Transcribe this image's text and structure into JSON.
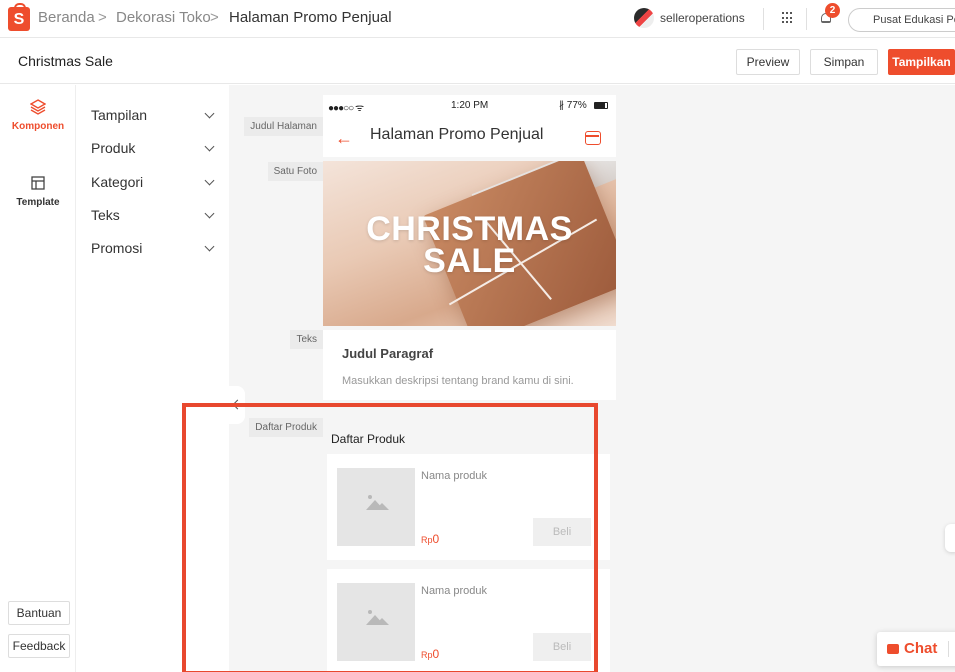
{
  "header": {
    "logo_letter": "S",
    "breadcrumbs": [
      "Beranda",
      "Dekorasi Toko",
      "Halaman Promo Penjual"
    ],
    "separator": ">",
    "username": "selleroperations",
    "notification_count": "2",
    "edu_button": "Pusat Edukasi Penjual"
  },
  "subheader": {
    "title": "Christmas Sale",
    "preview": "Preview",
    "save": "Simpan",
    "publish": "Tampilkan"
  },
  "rail": {
    "items": [
      {
        "label": "Komponen",
        "icon": "layers-icon",
        "active": true
      },
      {
        "label": "Template",
        "icon": "template-icon",
        "active": false
      }
    ],
    "help": "Bantuan",
    "feedback": "Feedback"
  },
  "components": [
    "Tampilan",
    "Produk",
    "Kategori",
    "Teks",
    "Promosi"
  ],
  "section_labels": [
    "Judul Halaman",
    "Satu Foto",
    "Teks",
    "Daftar Produk"
  ],
  "phone": {
    "status_left": "●●●○○ ᯤ",
    "time": "1:20 PM",
    "battery": "∦ 77%",
    "title": "Halaman Promo Penjual",
    "banner_line1": "CHRISTMAS",
    "banner_line2": "SALE",
    "para_title": "Judul Paragraf",
    "para_desc": "Masukkan deskripsi tentang brand kamu di sini.",
    "products_title": "Daftar Produk",
    "products": [
      {
        "name": "Nama produk",
        "currency": "Rp",
        "price": "0",
        "buy": "Beli"
      },
      {
        "name": "Nama produk",
        "currency": "Rp",
        "price": "0",
        "buy": "Beli"
      }
    ]
  },
  "chat": {
    "label": "Chat"
  },
  "colors": {
    "brand": "#ee4d2d",
    "highlight": "#e8482e"
  }
}
